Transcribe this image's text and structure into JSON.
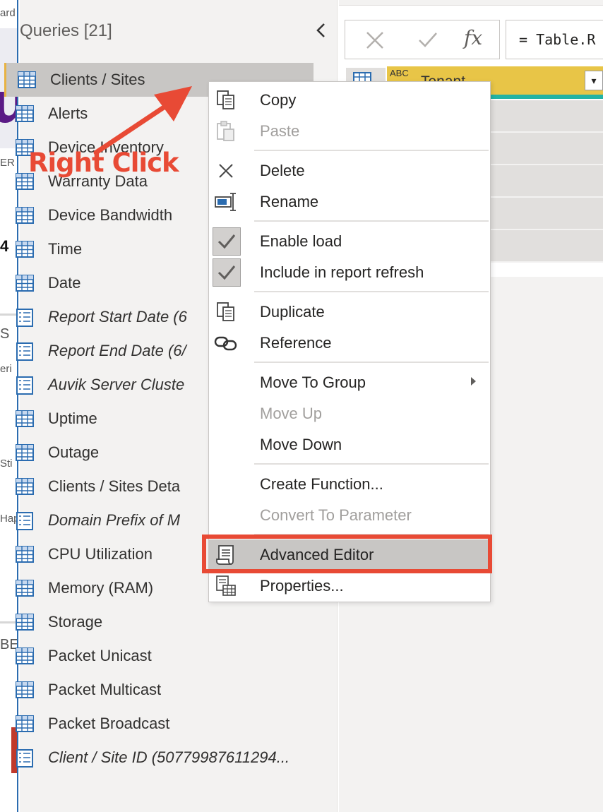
{
  "background": {
    "fragments": [
      "ard",
      "ER",
      "S",
      "eri",
      "Sti",
      "Hap",
      "BE"
    ],
    "logo_glyph": "u"
  },
  "queries_pane": {
    "title": "Queries [21]",
    "collapse_icon": "chevron-left-icon",
    "items": [
      {
        "label": "Clients / Sites",
        "type": "table",
        "selected": true
      },
      {
        "label": "Alerts",
        "type": "table"
      },
      {
        "label": "Device Inventory",
        "type": "table"
      },
      {
        "label": "Warranty Data",
        "type": "table"
      },
      {
        "label": "Device Bandwidth",
        "type": "table"
      },
      {
        "label": "Time",
        "type": "table"
      },
      {
        "label": "Date",
        "type": "table"
      },
      {
        "label": "Report Start Date (6",
        "type": "parameter"
      },
      {
        "label": "Report End Date (6/",
        "type": "parameter"
      },
      {
        "label": "Auvik Server Cluste",
        "type": "parameter"
      },
      {
        "label": "Uptime",
        "type": "table"
      },
      {
        "label": "Outage",
        "type": "table"
      },
      {
        "label": "Clients / Sites Deta",
        "type": "table"
      },
      {
        "label": "Domain Prefix of M",
        "type": "parameter"
      },
      {
        "label": "CPU Utilization",
        "type": "table"
      },
      {
        "label": "Memory (RAM)",
        "type": "table"
      },
      {
        "label": "Storage",
        "type": "table"
      },
      {
        "label": "Packet Unicast",
        "type": "table"
      },
      {
        "label": "Packet Multicast",
        "type": "table"
      },
      {
        "label": "Packet Broadcast",
        "type": "table"
      },
      {
        "label": "Client / Site ID (50779987611294...",
        "type": "parameter"
      }
    ]
  },
  "formula_bar": {
    "cancel_icon": "x-icon",
    "confirm_icon": "check-icon",
    "fx_label": "fx",
    "formula": "= Table.R"
  },
  "grid": {
    "column_type": "ABC",
    "column_name": "Tenant",
    "row_count": 5
  },
  "context_menu": {
    "items": [
      {
        "label": "Copy",
        "icon": "copy-icon",
        "enabled": true
      },
      {
        "label": "Paste",
        "icon": "paste-icon",
        "enabled": false
      },
      {
        "label": "Delete",
        "icon": "delete-icon",
        "enabled": true
      },
      {
        "label": "Rename",
        "icon": "rename-icon",
        "enabled": true
      },
      {
        "label": "Enable load",
        "icon": "check-icon",
        "enabled": true,
        "checked": true
      },
      {
        "label": "Include in report refresh",
        "icon": "check-icon",
        "enabled": true,
        "checked": true
      },
      {
        "label": "Duplicate",
        "icon": "duplicate-icon",
        "enabled": true
      },
      {
        "label": "Reference",
        "icon": "link-icon",
        "enabled": true
      },
      {
        "label": "Move To Group",
        "icon": "",
        "enabled": true,
        "submenu": true
      },
      {
        "label": "Move Up",
        "icon": "",
        "enabled": false
      },
      {
        "label": "Move Down",
        "icon": "",
        "enabled": true
      },
      {
        "label": "Create Function...",
        "icon": "",
        "enabled": true
      },
      {
        "label": "Convert To Parameter",
        "icon": "",
        "enabled": false
      },
      {
        "label": "Advanced Editor",
        "icon": "scroll-icon",
        "enabled": true,
        "highlighted": true
      },
      {
        "label": "Properties...",
        "icon": "properties-icon",
        "enabled": true
      }
    ]
  },
  "annotation": {
    "text": "Right Click",
    "color": "#e84a35"
  },
  "colors": {
    "pane_bg": "#f3f2f1",
    "selected_bg": "#c8c6c4",
    "column_header": "#e8c547",
    "column_header_underline": "#23b3a4",
    "table_icon": "#2b6cb0"
  }
}
